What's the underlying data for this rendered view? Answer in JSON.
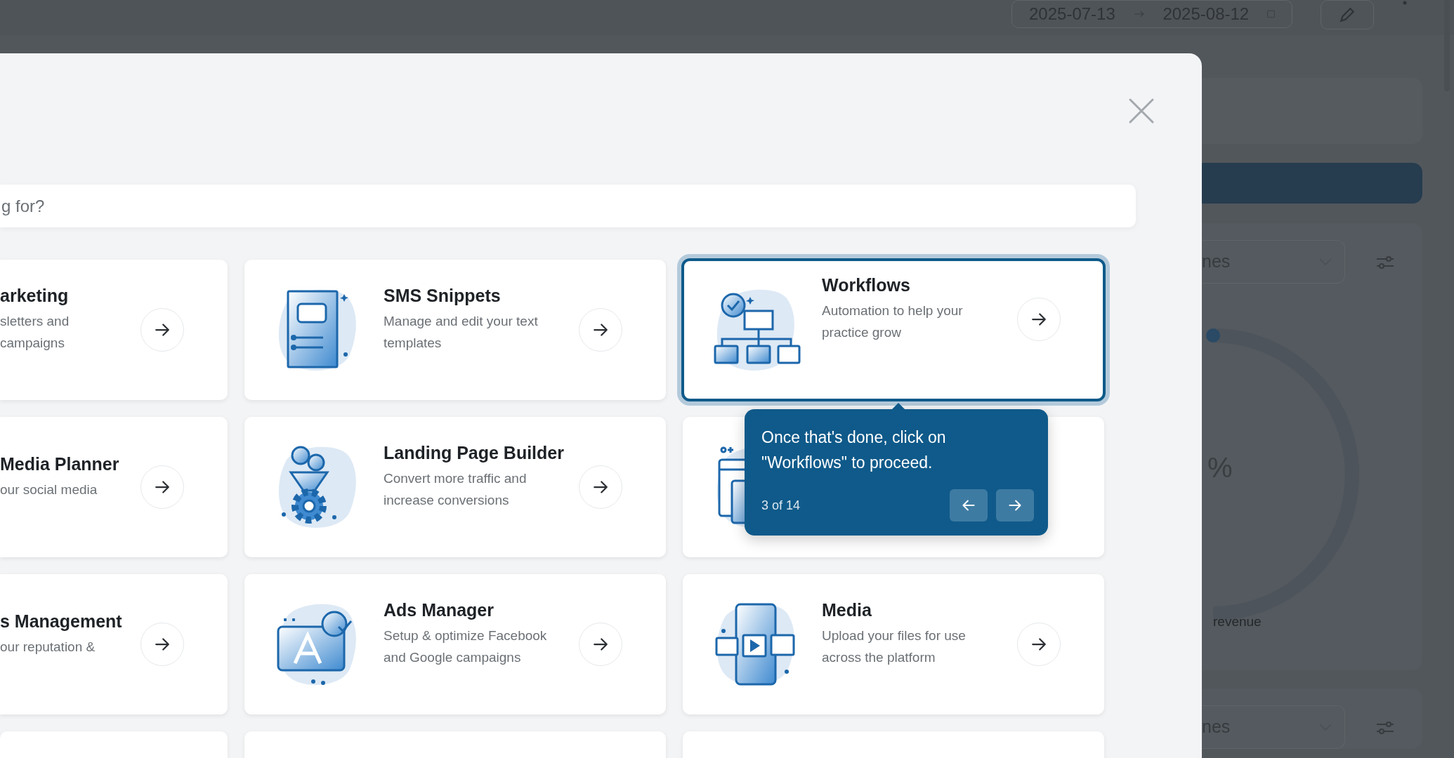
{
  "background": {
    "date_start": "2025-07-13",
    "date_end": "2025-08-12",
    "filters": [
      {
        "value": "nes"
      },
      {
        "value": "nes"
      }
    ],
    "gauge": {
      "value": "%",
      "caption": "revenue"
    }
  },
  "modal": {
    "search": {
      "placeholder": "g for?"
    },
    "cards": [
      {
        "kind": "cut",
        "title": "arketing",
        "description": [
          "sletters and",
          "campaigns"
        ],
        "selected": false
      },
      {
        "kind": "full",
        "title": "SMS Snippets",
        "description": [
          "Manage and edit your text",
          "templates"
        ],
        "selected": false
      },
      {
        "kind": "full",
        "title": "Workflows",
        "description": [
          "Automation to help your",
          "practice grow"
        ],
        "selected": true
      },
      {
        "kind": "cut",
        "title": "Media Planner",
        "description": [
          "our social media"
        ],
        "selected": false
      },
      {
        "kind": "full",
        "title": "Landing Page Builder",
        "description": [
          "Convert more traffic and",
          "increase conversions"
        ],
        "selected": false
      },
      {
        "kind": "covered",
        "selected": false
      },
      {
        "kind": "cut",
        "title": "s Management",
        "description": [
          "our reputation &"
        ],
        "selected": false
      },
      {
        "kind": "full",
        "title": "Ads Manager",
        "description": [
          "Setup & optimize Facebook",
          "and Google campaigns"
        ],
        "selected": false
      },
      {
        "kind": "full",
        "title": "Media",
        "description": [
          "Upload your files for use",
          "across the platform"
        ],
        "selected": false
      },
      {
        "kind": "empty",
        "selected": false
      },
      {
        "kind": "empty",
        "selected": false
      },
      {
        "kind": "empty",
        "selected": false
      }
    ]
  },
  "tour_tooltip": {
    "text": "Once that's done, click on \"Workflows\" to proceed.",
    "step": "3 of 14"
  }
}
